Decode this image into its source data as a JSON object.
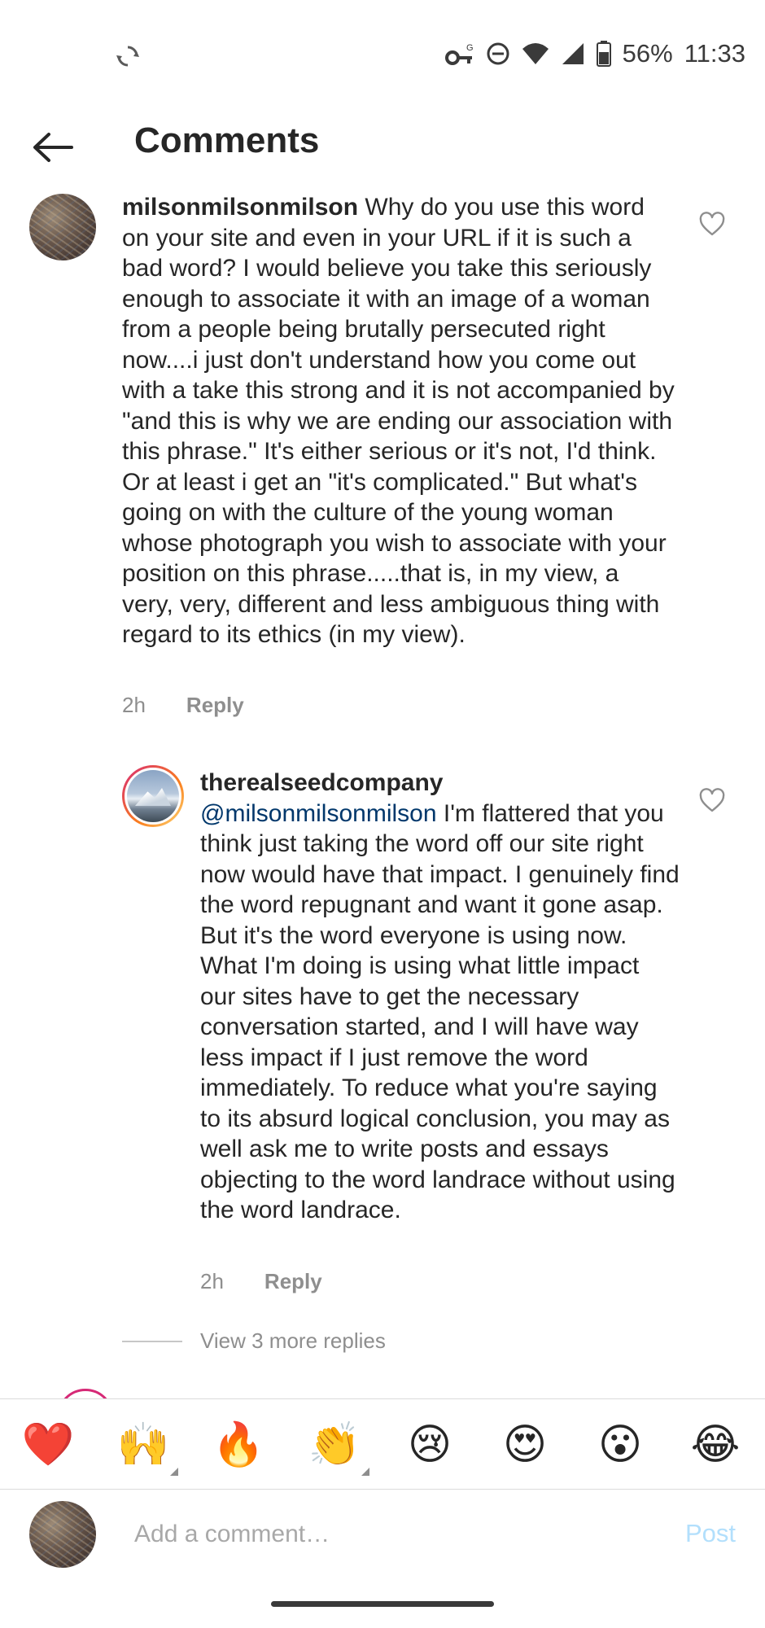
{
  "status_bar": {
    "battery_percent": "56%",
    "time": "11:33",
    "icons": [
      "sync-icon",
      "vpn-key-icon",
      "do-not-disturb-icon",
      "wifi-icon",
      "cell-signal-icon",
      "battery-icon"
    ]
  },
  "header": {
    "title": "Comments",
    "back_icon": "arrow-left-icon"
  },
  "comments": [
    {
      "username": "milsonmilsonmilson",
      "text": " Why do you use this word on your site and even in your URL if it is such a bad word? I would believe you take this seriously enough to associate it with an image of a woman from a people being brutally persecuted right now....i just don't understand how you come out with a take this strong and it is not accompanied by \"and this is why we are ending our association with this phrase.\" It's either serious or it's not, I'd think. Or at least i get an \"it's complicated.\" But what's going on with the culture of the young woman whose photograph you wish to associate with your position on this phrase.....that is, in my view, a very, very, different and less ambiguous thing with regard to its ethics (in my view).",
      "time": "2h",
      "reply_label": "Reply"
    },
    {
      "username": "therealseedcompany",
      "mention": "@milsonmilsonmilson",
      "text": " I'm flattered that you think just taking the word off our site right now would have that impact. I genuinely find the word repugnant and want it gone asap. But it's the word everyone is using now. What I'm doing is using what little impact our sites have to get the necessary conversation started, and I will have way less impact if I just remove the word immediately. To reduce what you're saying to its absurd logical conclusion, you may as well ask me to write posts and essays objecting to the word landrace without using the word landrace.",
      "time": "2h",
      "reply_label": "Reply"
    }
  ],
  "view_more_replies": "View 3 more replies",
  "emoji_bar": [
    {
      "name": "red-heart-emoji",
      "glyph": "❤️"
    },
    {
      "name": "raising-hands-emoji",
      "glyph": "🙌"
    },
    {
      "name": "fire-emoji",
      "glyph": "🔥"
    },
    {
      "name": "clapping-hands-emoji",
      "glyph": "👏"
    },
    {
      "name": "crying-face-emoji",
      "glyph": "😢"
    },
    {
      "name": "heart-eyes-emoji",
      "glyph": "😍"
    },
    {
      "name": "astonished-face-emoji",
      "glyph": "😮"
    },
    {
      "name": "tears-of-joy-emoji",
      "glyph": "😂"
    }
  ],
  "composer": {
    "placeholder": "Add a comment…",
    "post_label": "Post"
  },
  "colors": {
    "mention": "#00376b",
    "meta_gray": "#8e8e8e",
    "post_disabled": "#b2dffc",
    "ring_start": "#d62976",
    "ring_end": "#feda75"
  }
}
